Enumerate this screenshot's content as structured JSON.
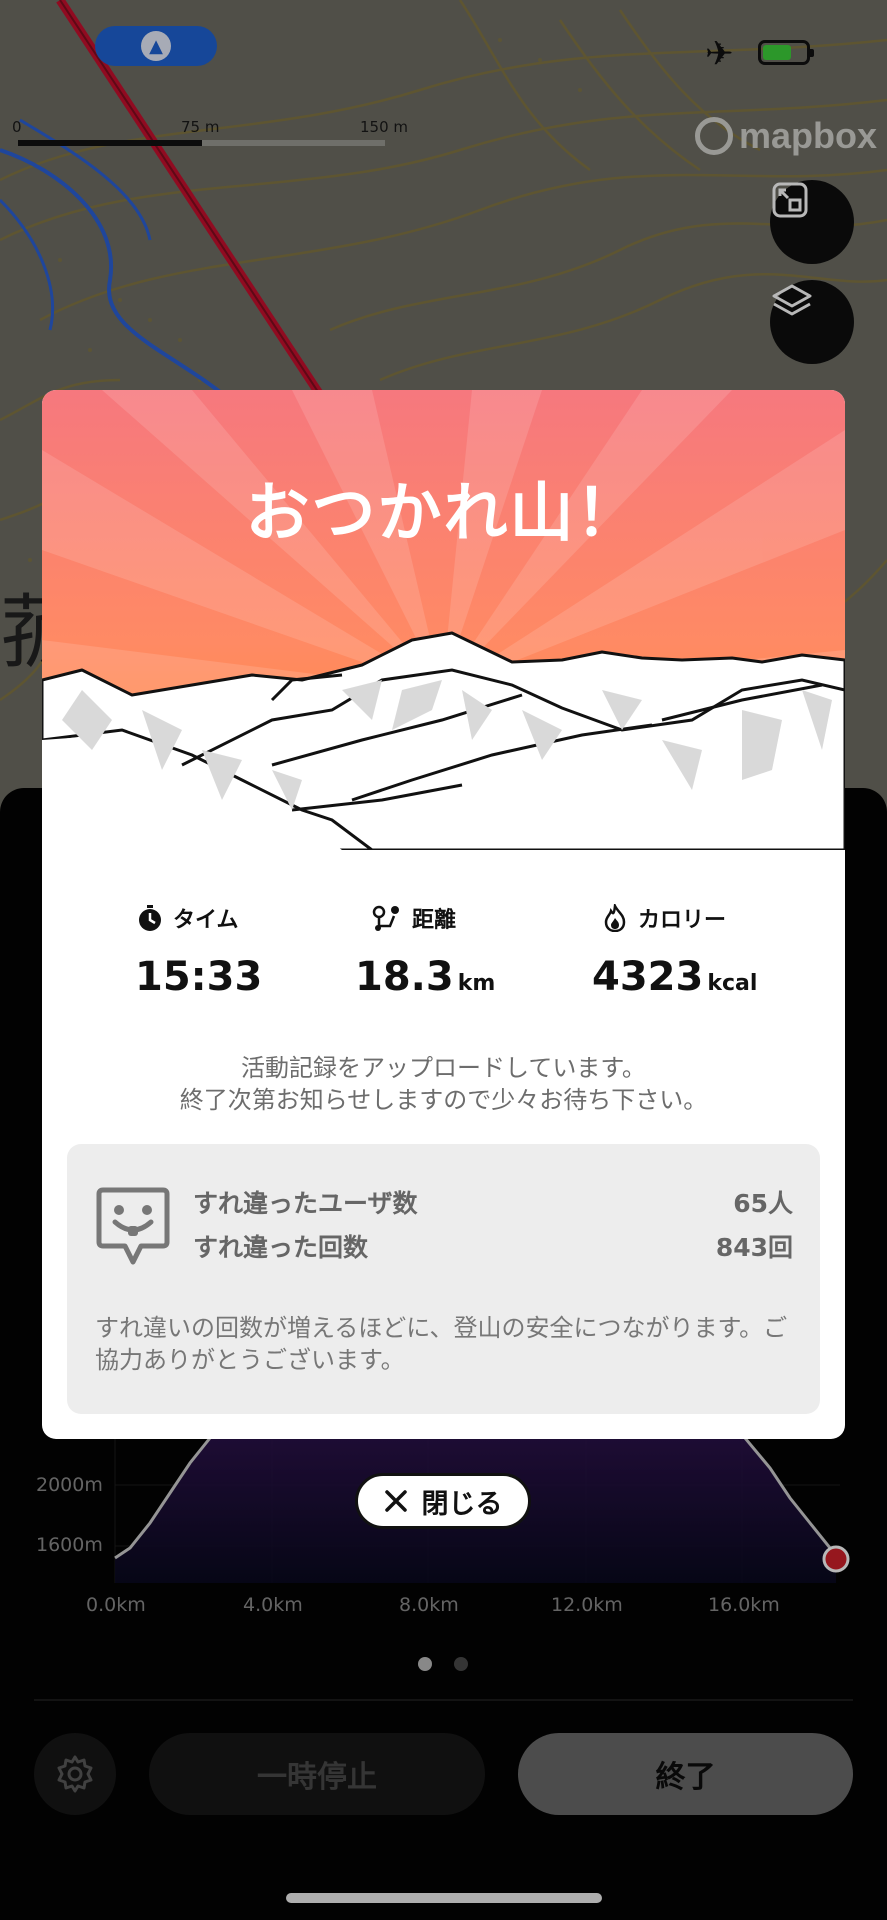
{
  "map": {
    "scale_labels": [
      "0",
      "75 m",
      "150 m"
    ],
    "attribution": "mapbox",
    "icons": {
      "locate": "navigation-arrow-icon",
      "expand": "expand-icon",
      "layers": "layers-icon",
      "airplane": "airplane-icon",
      "battery": "battery-charging-icon"
    }
  },
  "colors": {
    "accent": "#ff8a5c",
    "route": "#c8102e",
    "water": "#2b62d8",
    "end_marker": "#d0202a"
  },
  "summary": {
    "title": "おつかれ山！",
    "stats": [
      {
        "icon": "stopwatch-icon",
        "label": "タイム",
        "value": "15:33",
        "unit": ""
      },
      {
        "icon": "route-icon",
        "label": "距離",
        "value": "18.3",
        "unit": "km"
      },
      {
        "icon": "flame-icon",
        "label": "カロリー",
        "value": "4323",
        "unit": "kcal"
      }
    ],
    "upload_line1": "活動記録をアップロードしています。",
    "upload_line2": "終了次第お知らせしますので少々お待ち下さい。",
    "encounter": {
      "icon": "encounter-face-icon",
      "users_label": "すれ違ったユーザ数",
      "users_value": "65人",
      "times_label": "すれ違った回数",
      "times_value": "843回",
      "note": "すれ違いの回数が増えるほどに、登山の安全につながります。ご協力ありがとうございます。"
    }
  },
  "close_button": {
    "label": "閉じる",
    "icon": "close-icon"
  },
  "chart": {
    "y_ticks": [
      "2000m",
      "1600m"
    ],
    "x_ticks": [
      "0.0km",
      "4.0km",
      "8.0km",
      "12.0km",
      "16.0km"
    ]
  },
  "pager": {
    "count": 2,
    "active": 0
  },
  "controls": {
    "settings_icon": "gear-icon",
    "pause_label": "一時停止",
    "end_label": "終了"
  }
}
